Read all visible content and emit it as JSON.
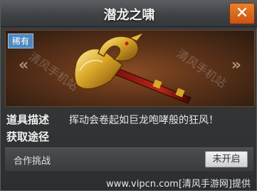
{
  "dialog": {
    "title": "潜龙之啸",
    "close_icon": "close-x-icon"
  },
  "item": {
    "rarity": "稀有",
    "description_label": "道具描述",
    "description": "挥动会卷起如巨龙咆哮般的狂风！",
    "obtain_label": "获取途径"
  },
  "obtain": {
    "method": "合作挑战",
    "status": "未开启"
  },
  "watermark": {
    "left": "清风手机站",
    "right": "清风手机站",
    "footer": "www.vipcn.com[清风手游网]提供"
  },
  "colors": {
    "accent_orange": "#d9661c",
    "rarity_blue": "#4f89bd"
  }
}
